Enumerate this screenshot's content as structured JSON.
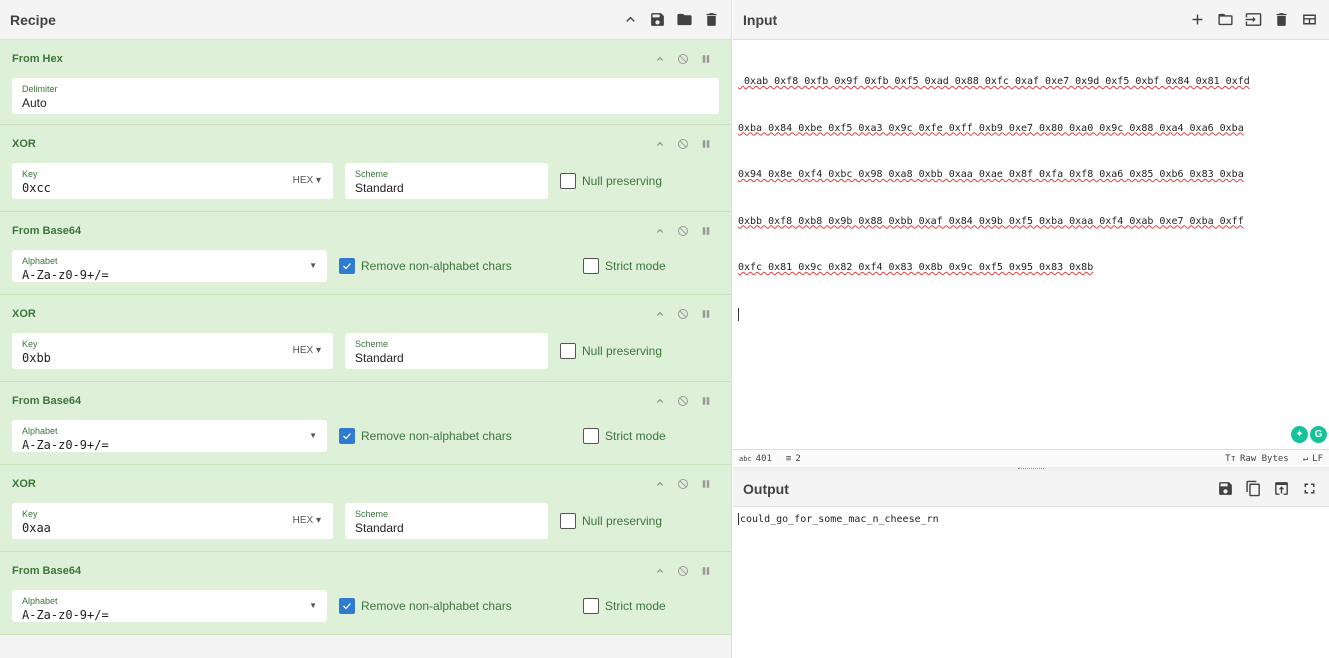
{
  "recipe": {
    "title": "Recipe",
    "operations": [
      {
        "name": "From Hex",
        "type": "fromhex",
        "delimiter_label": "Delimiter",
        "delimiter": "Auto"
      },
      {
        "name": "XOR",
        "type": "xor",
        "key_label": "Key",
        "key": "0xcc",
        "key_format": "HEX",
        "scheme_label": "Scheme",
        "scheme": "Standard",
        "null_label": "Null preserving",
        "null_checked": false
      },
      {
        "name": "From Base64",
        "type": "b64",
        "alphabet_label": "Alphabet",
        "alphabet": "A-Za-z0-9+/=",
        "remove_label": "Remove non-alphabet chars",
        "remove_checked": true,
        "strict_label": "Strict mode",
        "strict_checked": false
      },
      {
        "name": "XOR",
        "type": "xor",
        "key_label": "Key",
        "key": "0xbb",
        "key_format": "HEX",
        "scheme_label": "Scheme",
        "scheme": "Standard",
        "null_label": "Null preserving",
        "null_checked": false
      },
      {
        "name": "From Base64",
        "type": "b64",
        "alphabet_label": "Alphabet",
        "alphabet": "A-Za-z0-9+/=",
        "remove_label": "Remove non-alphabet chars",
        "remove_checked": true,
        "strict_label": "Strict mode",
        "strict_checked": false
      },
      {
        "name": "XOR",
        "type": "xor",
        "key_label": "Key",
        "key": "0xaa",
        "key_format": "HEX",
        "scheme_label": "Scheme",
        "scheme": "Standard",
        "null_label": "Null preserving",
        "null_checked": false
      },
      {
        "name": "From Base64",
        "type": "b64",
        "alphabet_label": "Alphabet",
        "alphabet": "A-Za-z0-9+/=",
        "remove_label": "Remove non-alphabet chars",
        "remove_checked": true,
        "strict_label": "Strict mode",
        "strict_checked": false
      }
    ]
  },
  "input": {
    "title": "Input",
    "lines": [
      " 0xab 0xf8 0xfb 0x9f 0xfb 0xf5 0xad 0x88 0xfc 0xaf 0xe7 0x9d 0xf5 0xbf 0x84 0x81 0xfd",
      "0xba 0x84 0xbe 0xf5 0xa3 0x9c 0xfe 0xff 0xb9 0xe7 0x80 0xa0 0x9c 0x88 0xa4 0xa6 0xba",
      "0x94 0x8e 0xf4 0xbc 0x98 0xa8 0xbb 0xaa 0xae 0x8f 0xfa 0xf8 0xa6 0x85 0xb6 0x83 0xba",
      "0xbb 0xf8 0xb8 0x9b 0x88 0xbb 0xaf 0x84 0x9b 0xf5 0xba 0xaa 0xf4 0xab 0xe7 0xba 0xff",
      "0xfc 0x81 0x9c 0x82 0xf4 0x83 0x8b 0x9c 0xf5 0x95 0x83 0x8b"
    ],
    "status": {
      "chars": "401",
      "lines": "2",
      "encoding": "Raw Bytes",
      "eol": "LF"
    }
  },
  "output": {
    "title": "Output",
    "text": "could_go_for_some_mac_n_cheese_rn"
  }
}
